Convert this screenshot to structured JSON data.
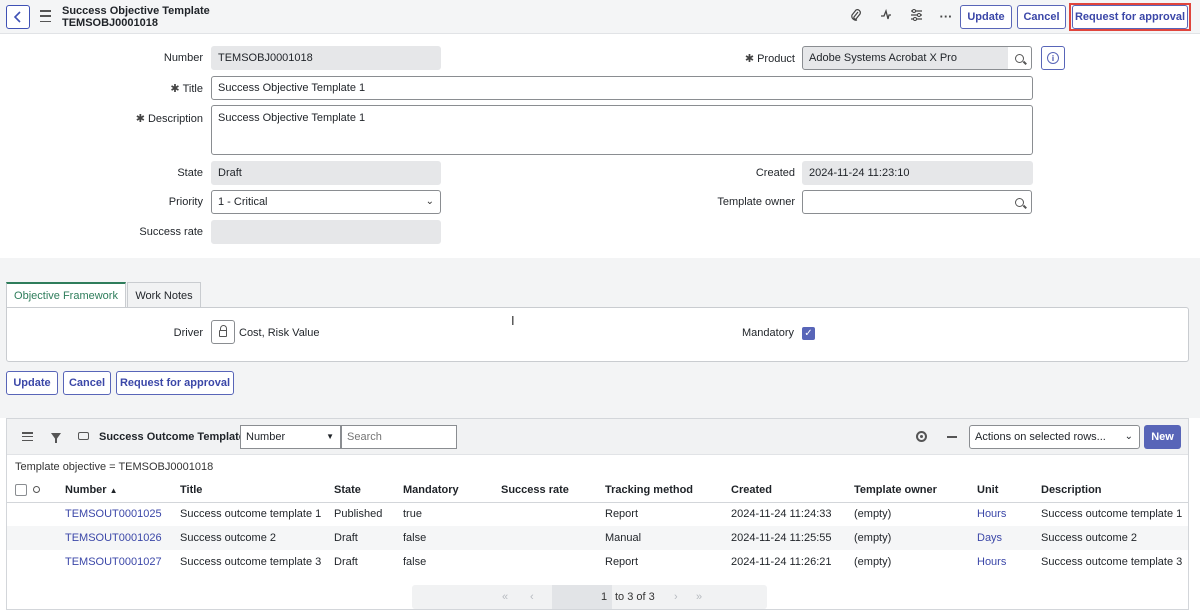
{
  "header": {
    "title": "Success Objective Template",
    "record_number": "TEMSOBJ0001018",
    "buttons": {
      "update": "Update",
      "cancel": "Cancel",
      "request_approval": "Request for approval"
    },
    "icons": [
      "paperclip-icon",
      "activity-icon",
      "settings-sliders-icon",
      "more-icon"
    ]
  },
  "form": {
    "number_label": "Number",
    "number_value": "TEMSOBJ0001018",
    "product_label": "Product",
    "product_value": "Adobe Systems Acrobat X Pro",
    "title_label": "Title",
    "title_value": "Success Objective Template 1",
    "description_label": "Description",
    "description_value": "Success Objective Template 1",
    "state_label": "State",
    "state_value": "Draft",
    "created_label": "Created",
    "created_value": "2024-11-24 11:23:10",
    "priority_label": "Priority",
    "priority_value": "1 - Critical",
    "template_owner_label": "Template owner",
    "template_owner_value": "",
    "success_rate_label": "Success rate",
    "success_rate_value": ""
  },
  "tabs": [
    {
      "label": "Objective Framework",
      "active": true
    },
    {
      "label": "Work Notes",
      "active": false
    }
  ],
  "framework": {
    "driver_label": "Driver",
    "driver_value": "Cost, Risk Value",
    "mandatory_label": "Mandatory",
    "mandatory_checked": true
  },
  "bottom_buttons": {
    "update": "Update",
    "cancel": "Cancel",
    "request_approval": "Request for approval"
  },
  "related_list": {
    "title": "Success Outcome Templates",
    "search_field": "Number",
    "search_placeholder": "Search",
    "actions": "Actions on selected rows...",
    "new_label": "New",
    "breadcrumb": "Template objective = TEMSOBJ0001018",
    "columns": [
      "Number",
      "Title",
      "State",
      "Mandatory",
      "Success rate",
      "Tracking method",
      "Created",
      "Template owner",
      "Unit",
      "Description"
    ],
    "sort_indicator": "▲",
    "rows": [
      [
        "TEMSOUT0001025",
        "Success outcome template 1",
        "Published",
        "true",
        "",
        "Report",
        "2024-11-24 11:24:33",
        "(empty)",
        "Hours",
        "Success outcome template 1"
      ],
      [
        "TEMSOUT0001026",
        "Success outcome 2",
        "Draft",
        "false",
        "",
        "Manual",
        "2024-11-24 11:25:55",
        "(empty)",
        "Days",
        "Success outcome 2"
      ],
      [
        "TEMSOUT0001027",
        "Success outcome template 3",
        "Draft",
        "false",
        "",
        "Report",
        "2024-11-24 11:26:21",
        "(empty)",
        "Hours",
        "Success outcome template 3"
      ]
    ],
    "pager": {
      "current": "1",
      "range": "to 3 of 3"
    }
  },
  "colors": {
    "accent": "#5865b8",
    "link": "#3b47a8",
    "active_tab": "#2e7d5b",
    "highlight": "#e0453c"
  }
}
